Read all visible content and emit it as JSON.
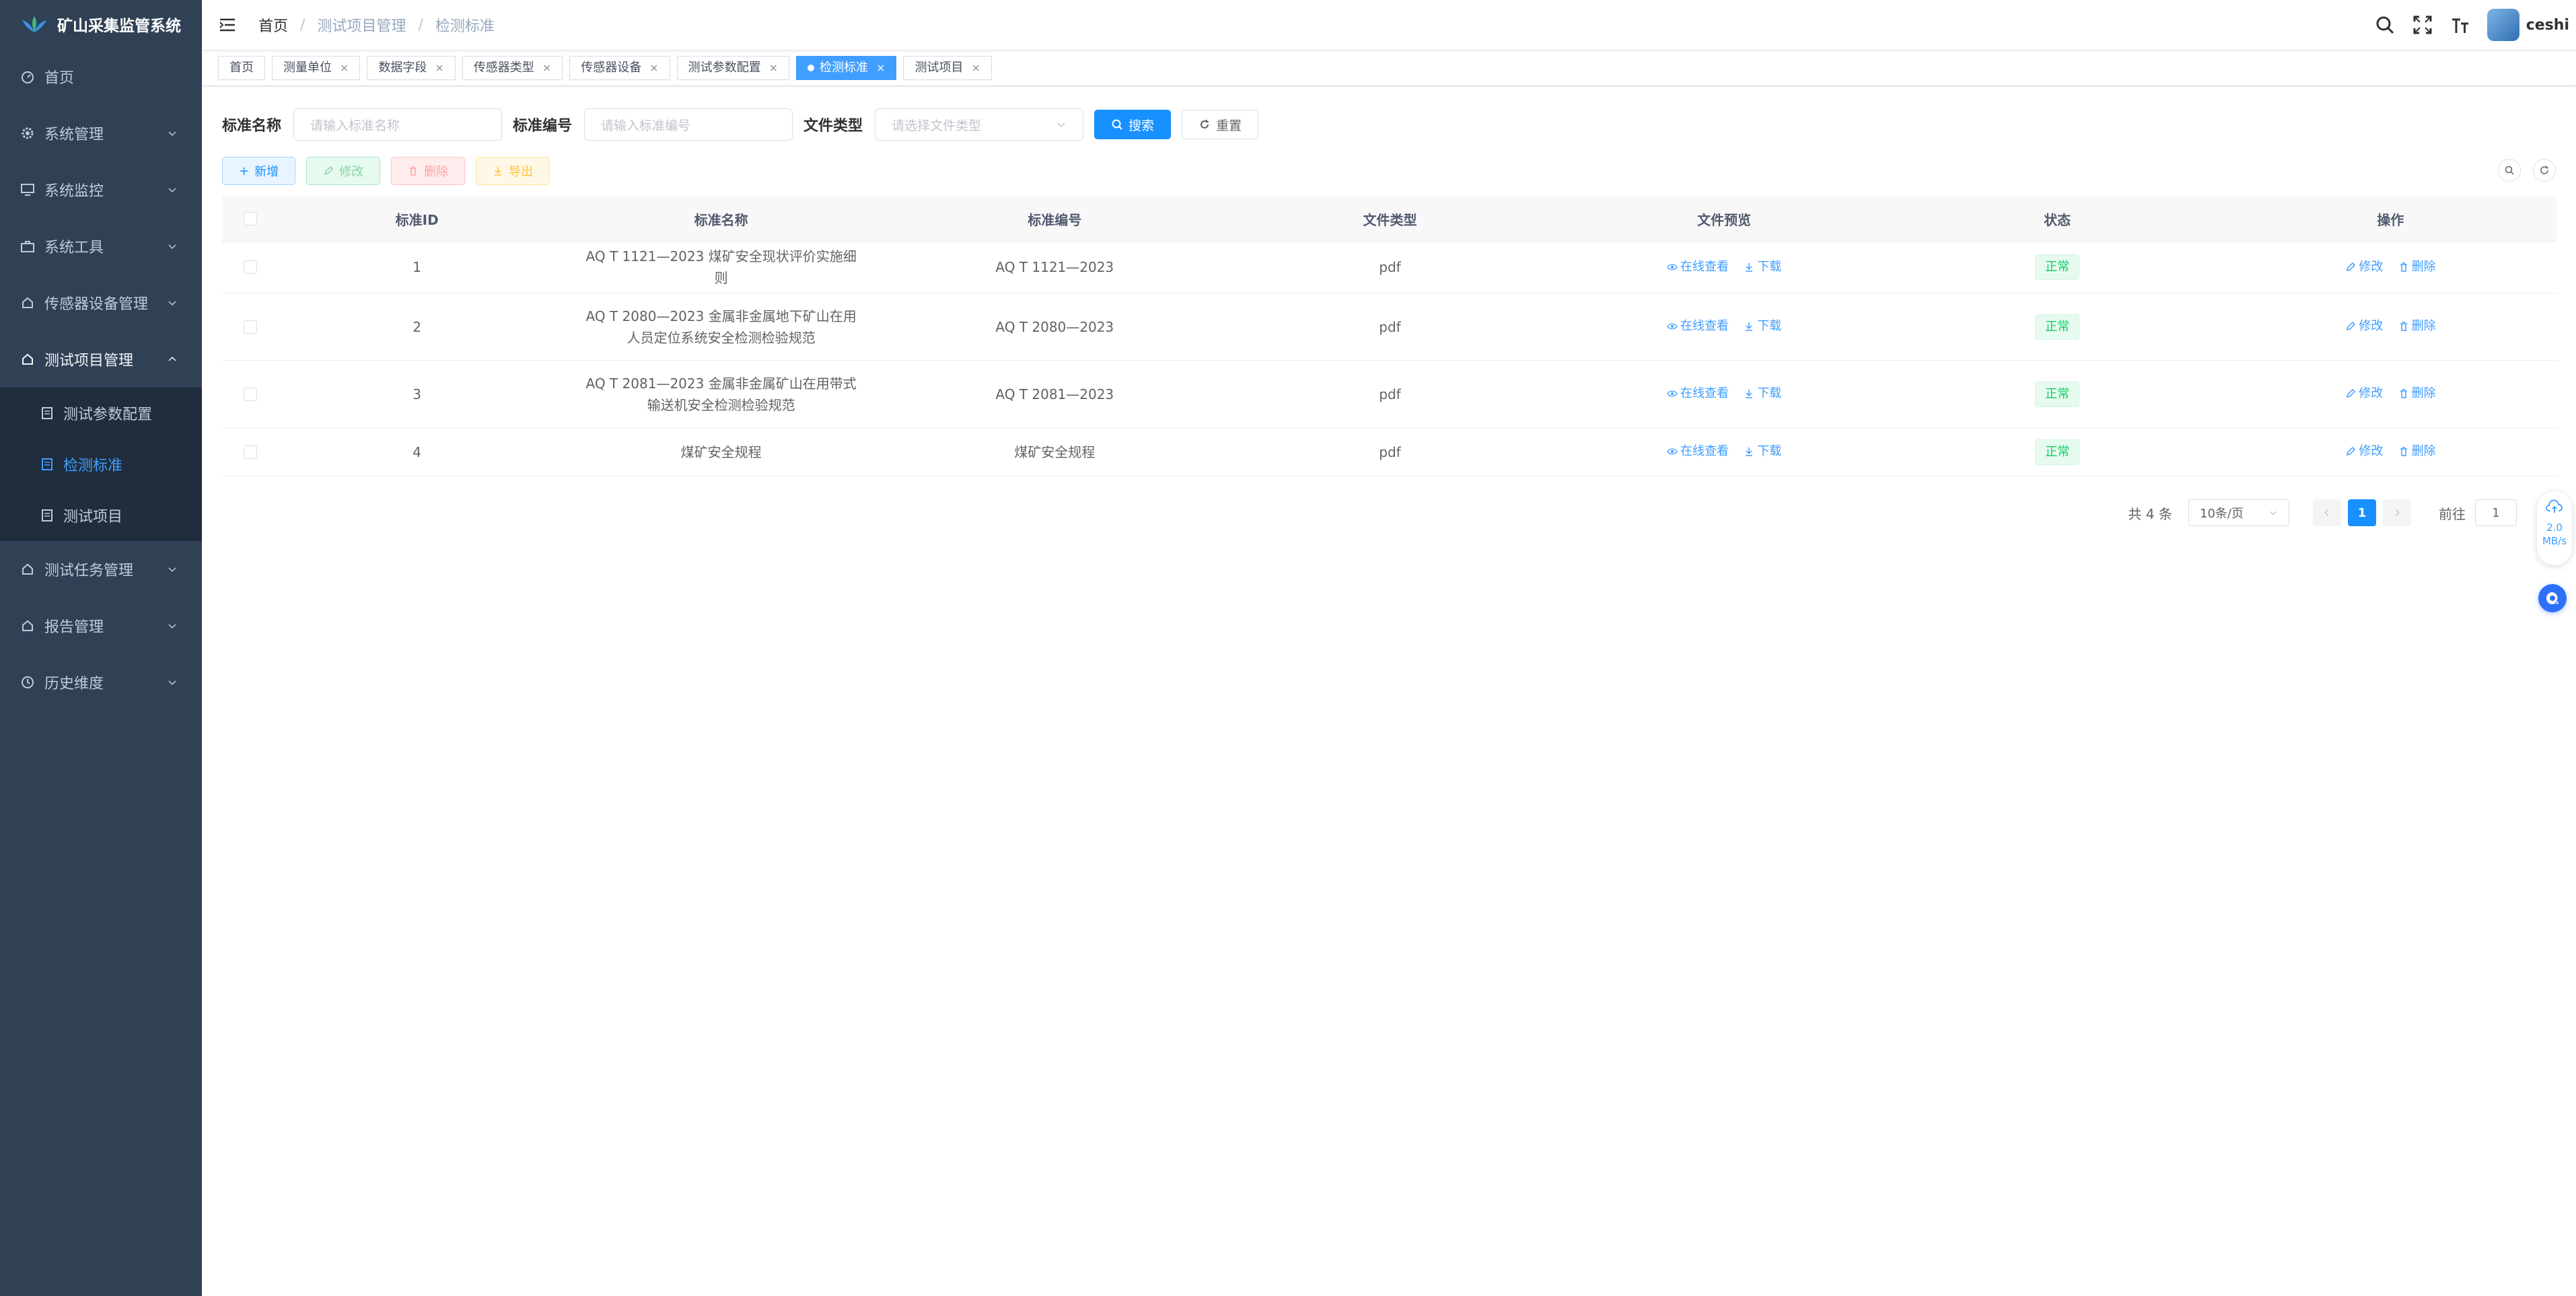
{
  "app": {
    "title": "矿山采集监管系统"
  },
  "sidebar": {
    "items": [
      {
        "label": "首页",
        "icon": "dashboard-icon"
      },
      {
        "label": "系统管理",
        "icon": "gear-icon"
      },
      {
        "label": "系统监控",
        "icon": "monitor-icon"
      },
      {
        "label": "系统工具",
        "icon": "toolbox-icon"
      },
      {
        "label": "传感器设备管理",
        "icon": "sensor-icon"
      },
      {
        "label": "测试项目管理",
        "icon": "project-icon"
      },
      {
        "label": "测试任务管理",
        "icon": "task-icon"
      },
      {
        "label": "报告管理",
        "icon": "report-icon"
      },
      {
        "label": "历史维度",
        "icon": "history-icon"
      }
    ],
    "sub_items": [
      {
        "label": "测试参数配置",
        "icon": "document-icon"
      },
      {
        "label": "检测标准",
        "icon": "document-icon"
      },
      {
        "label": "测试项目",
        "icon": "document-icon"
      }
    ]
  },
  "navbar": {
    "breadcrumb": [
      "首页",
      "测试项目管理",
      "检测标准"
    ],
    "username": "ceshi"
  },
  "tags": [
    "首页",
    "测量单位",
    "数据字段",
    "传感器类型",
    "传感器设备",
    "测试参数配置",
    "检测标准",
    "测试项目"
  ],
  "search": {
    "name_label": "标准名称",
    "name_placeholder": "请输入标准名称",
    "code_label": "标准编号",
    "code_placeholder": "请输入标准编号",
    "type_label": "文件类型",
    "type_placeholder": "请选择文件类型",
    "search_btn": "搜索",
    "reset_btn": "重置"
  },
  "toolbar": {
    "add": "新增",
    "edit": "修改",
    "delete": "删除",
    "export": "导出"
  },
  "table": {
    "headers": [
      "标准ID",
      "标准名称",
      "标准编号",
      "文件类型",
      "文件预览",
      "状态",
      "操作"
    ],
    "rows": [
      {
        "id": "1",
        "name": "AQ T 1121—2023 煤矿安全现状评价实施细则",
        "code": "AQ T 1121—2023",
        "type": "pdf",
        "status": "正常"
      },
      {
        "id": "2",
        "name": "AQ T 2080—2023 金属非金属地下矿山在用人员定位系统安全检测检验规范",
        "code": "AQ T 2080—2023",
        "type": "pdf",
        "status": "正常"
      },
      {
        "id": "3",
        "name": "AQ T 2081—2023 金属非金属矿山在用带式输送机安全检测检验规范",
        "code": "AQ T 2081—2023",
        "type": "pdf",
        "status": "正常"
      },
      {
        "id": "4",
        "name": "煤矿安全规程",
        "code": "煤矿安全规程",
        "type": "pdf",
        "status": "正常"
      }
    ],
    "view_label": "在线查看",
    "download_label": "下载",
    "edit_label": "修改",
    "delete_label": "删除"
  },
  "pagination": {
    "total": "共 4 条",
    "page_size": "10条/页",
    "current": "1",
    "goto_label": "前往",
    "goto_value": "1"
  },
  "float": {
    "speed_value": "2.0",
    "speed_unit": "MB/s"
  },
  "colors": {
    "sidebar_bg": "#304156",
    "primary": "#1890ff",
    "active_tag": "#409eff",
    "success": "#13ce66"
  }
}
